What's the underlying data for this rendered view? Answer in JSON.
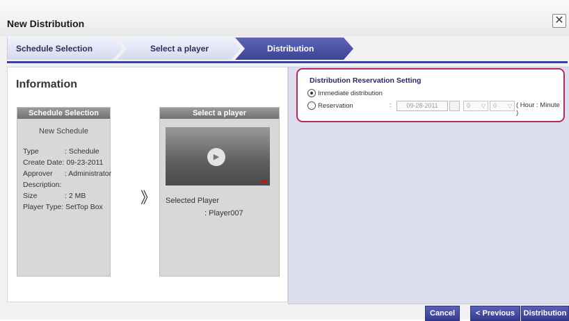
{
  "dialog": {
    "title": "New Distribution",
    "close_label": "✕"
  },
  "steps": [
    {
      "label": "Schedule Selection",
      "active": false
    },
    {
      "label": "Select a player",
      "active": false
    },
    {
      "label": "Distribution",
      "active": true
    }
  ],
  "info": {
    "title": "Information",
    "schedule_card": {
      "header": "Schedule Selection",
      "name": "New Schedule",
      "fields": [
        {
          "label": "Type",
          "value": ": Schedule"
        },
        {
          "label": "Create Date",
          "value": ": 09-23-2011"
        },
        {
          "label": "Approver",
          "value": ": Administrator"
        },
        {
          "label": "Description",
          "value": ":"
        },
        {
          "label": "Size",
          "value": ": 2 MB"
        },
        {
          "label": "Player Type",
          "value": ": SetTop Box"
        }
      ]
    },
    "arrow": "》",
    "player_card": {
      "header": "Select a player",
      "selected_label": "Selected Player",
      "selected_value": ":   Player007"
    }
  },
  "reservation": {
    "title": "Distribution Reservation Setting",
    "immediate_label": "Immediate distribution",
    "reservation_label": "Reservation",
    "colon": ":",
    "date": "09-28-2011",
    "hour": "0",
    "minute": "0",
    "unit": "( Hour : Minute )",
    "selected": "immediate"
  },
  "buttons": {
    "cancel": "Cancel",
    "previous": "< Previous",
    "distribution": "Distribution"
  },
  "colors": {
    "accent": "#3c4396",
    "highlight_border": "#b42a55",
    "panel_bg": "#dcdeef"
  }
}
